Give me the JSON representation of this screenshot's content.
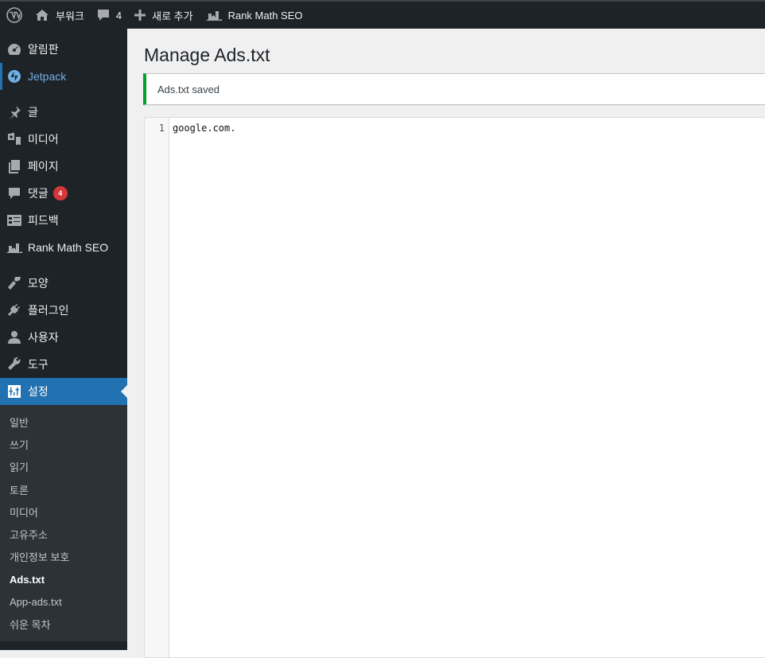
{
  "adminbar": {
    "site_name": "부워크",
    "comments_count": "4",
    "new_label": "새로 추가",
    "rank_math_label": "Rank Math SEO"
  },
  "menu": {
    "items": [
      {
        "label": "알림판",
        "icon": "dashboard-icon"
      },
      {
        "label": "Jetpack",
        "icon": "jetpack-icon"
      },
      {
        "label": "글",
        "icon": "pin-icon"
      },
      {
        "label": "미디어",
        "icon": "media-icon"
      },
      {
        "label": "페이지",
        "icon": "pages-icon"
      },
      {
        "label": "댓글",
        "icon": "comments-icon",
        "badge": "4"
      },
      {
        "label": "피드백",
        "icon": "feedback-icon"
      },
      {
        "label": "Rank Math SEO",
        "icon": "rank-math-icon"
      },
      {
        "label": "모양",
        "icon": "appearance-icon"
      },
      {
        "label": "플러그인",
        "icon": "plugins-icon"
      },
      {
        "label": "사용자",
        "icon": "users-icon"
      },
      {
        "label": "도구",
        "icon": "tools-icon"
      },
      {
        "label": "설정",
        "icon": "settings-icon"
      }
    ],
    "submenu": [
      "일반",
      "쓰기",
      "읽기",
      "토론",
      "미디어",
      "고유주소",
      "개인정보 보호",
      "Ads.txt",
      "App-ads.txt",
      "쉬운 목차"
    ]
  },
  "page": {
    "title": "Manage Ads.txt",
    "notice": "Ads.txt saved",
    "editor": {
      "line_numbers": [
        "1"
      ],
      "lines": [
        "google.com."
      ]
    }
  },
  "colors": {
    "accent": "#2271b1",
    "success": "#00a32a",
    "badge": "#d63638"
  }
}
